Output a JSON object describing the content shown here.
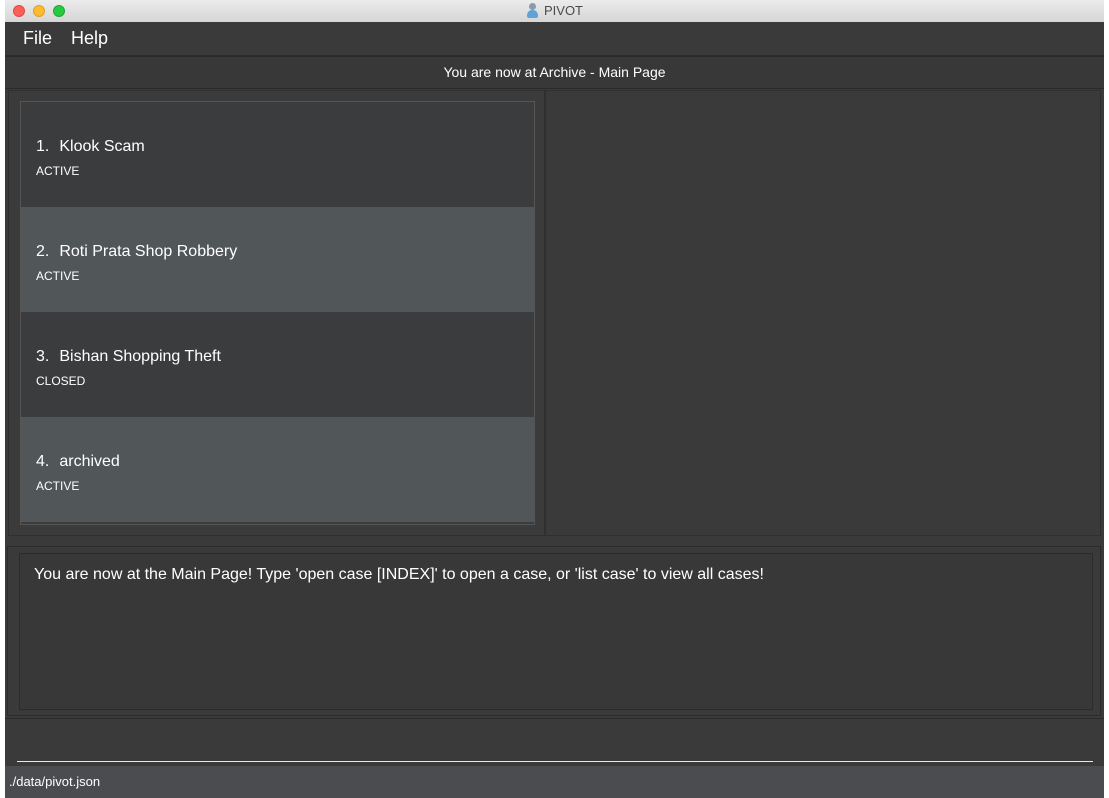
{
  "window": {
    "title": "PIVOT"
  },
  "menu": {
    "file": "File",
    "help": "Help"
  },
  "breadcrumb": "You are now at Archive - Main Page",
  "cases": [
    {
      "index": "1.",
      "title": "Klook Scam",
      "status": "ACTIVE"
    },
    {
      "index": "2.",
      "title": "Roti Prata Shop Robbery",
      "status": "ACTIVE"
    },
    {
      "index": "3.",
      "title": "Bishan Shopping Theft",
      "status": "CLOSED"
    },
    {
      "index": "4.",
      "title": "archived",
      "status": "ACTIVE"
    }
  ],
  "result": {
    "message": "You are now at the Main Page! Type 'open case [INDEX]' to open a case, or 'list case' to view all cases!"
  },
  "command": {
    "value": "",
    "placeholder": ""
  },
  "status_bar": {
    "path": "./data/pivot.json"
  },
  "colors": {
    "background": "#3a3a3a",
    "row_alt": "#515659",
    "text": "#ffffff"
  },
  "icons": {
    "app": "detective-person-icon"
  }
}
